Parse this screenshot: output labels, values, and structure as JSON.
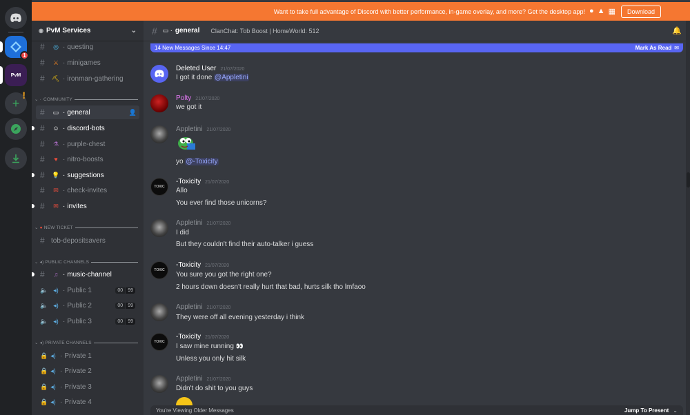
{
  "banner": {
    "text": "Want to take full advantage of Discord with better performance, in-game overlay, and more? Get the desktop app!",
    "download_label": "Download",
    "color": "#f57731"
  },
  "guilds": {
    "blue_badge": "1",
    "pvm_label": "PvM"
  },
  "server": {
    "name": "PvM Services",
    "top_channels": [
      {
        "name": "questing",
        "emoji": "◎"
      },
      {
        "name": "minigames",
        "emoji": "⚔"
      },
      {
        "name": "ironman-gathering",
        "emoji": "⛏"
      }
    ],
    "categories": {
      "community": "COMMUNITY",
      "new_ticket": "NEW TICKET",
      "public": "PUBLIC CHANNELS",
      "private": "PRIVATE CHANNELS"
    },
    "community_channels": [
      {
        "name": "general",
        "emoji": "▭"
      },
      {
        "name": "discord-bots",
        "emoji": "☺"
      },
      {
        "name": "purple-chest",
        "emoji": "⚗"
      },
      {
        "name": "nitro-boosts",
        "emoji": "♥"
      },
      {
        "name": "suggestions",
        "emoji": "💡"
      },
      {
        "name": "check-invites",
        "emoji": "✉"
      },
      {
        "name": "invites",
        "emoji": "✉"
      }
    ],
    "ticket_channels": [
      {
        "name": "tob-depositsavers"
      }
    ],
    "music_channel": {
      "name": "music-channel",
      "emoji": "♫"
    },
    "public_voice": [
      {
        "name": "Public 1",
        "count_a": "00",
        "count_b": "99"
      },
      {
        "name": "Public 2",
        "count_a": "00",
        "count_b": "99"
      },
      {
        "name": "Public 3",
        "count_a": "00",
        "count_b": "99"
      }
    ],
    "private_voice": [
      {
        "name": "Private 1"
      },
      {
        "name": "Private 2"
      },
      {
        "name": "Private 3"
      },
      {
        "name": "Private 4"
      }
    ]
  },
  "channel": {
    "name": "general",
    "topic": "ClanChat: Tob Boost | HomeWorld: 512"
  },
  "new_messages_bar": {
    "text": "14 New Messages Since 14:47",
    "mark_label": "Mark As Read"
  },
  "messages": [
    {
      "author": "Deleted User",
      "time": "21/07/2020",
      "lines": [
        "I got it done "
      ],
      "mention": "@Appletini"
    },
    {
      "author": "Polty",
      "time": "21/07/2020",
      "lines": [
        "we got it"
      ]
    },
    {
      "author": "Appletini",
      "time": "21/07/2020",
      "lines": [
        "yo "
      ],
      "mention": "@-Toxicity"
    },
    {
      "author": "-Toxicity",
      "time": "21/07/2020",
      "lines": [
        "Allo",
        "You ever find those unicorns?"
      ]
    },
    {
      "author": "Appletini",
      "time": "21/07/2020",
      "lines": [
        "I did",
        "But they couldn't find their auto-talker i guess"
      ]
    },
    {
      "author": "-Toxicity",
      "time": "21/07/2020",
      "lines": [
        "You sure you got the right one?",
        "2 hours down doesn't really hurt that bad, hurts silk tho lmfaoo"
      ]
    },
    {
      "author": "Appletini",
      "time": "21/07/2020",
      "lines": [
        "They were off all evening yesterday i think"
      ]
    },
    {
      "author": "-Toxicity",
      "time": "21/07/2020",
      "lines": [
        "I saw mine running ",
        "Unless you only hit silk"
      ]
    },
    {
      "author": "Appletini",
      "time": "21/07/2020",
      "lines": [
        "Didn't do shit to you guys"
      ]
    }
  ],
  "older_bar": {
    "text": "You're Viewing Older Messages",
    "jump_label": "Jump To Present"
  },
  "colors": {
    "accent": "#5865f2",
    "polty": "#e879f9",
    "mention": "#99aaff"
  }
}
